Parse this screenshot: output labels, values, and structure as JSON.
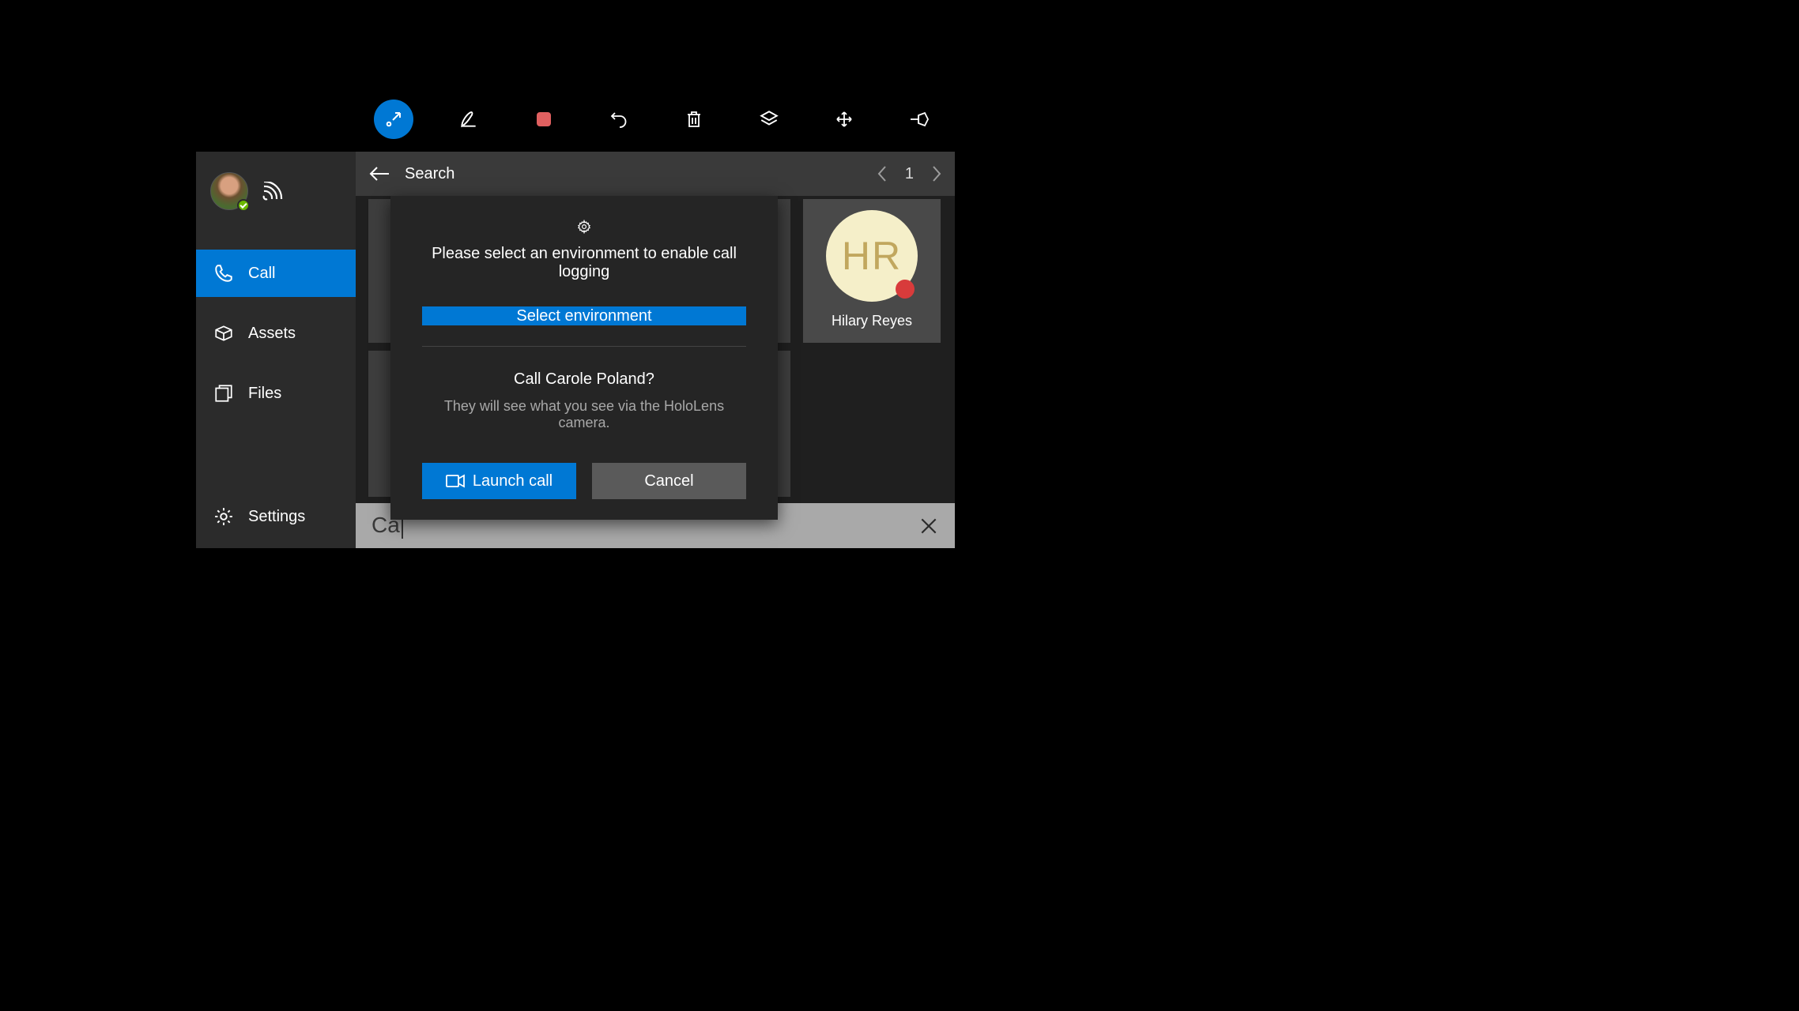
{
  "toolbar": {
    "icons": [
      "follow-icon",
      "ink-icon",
      "stop-record-icon",
      "undo-icon",
      "delete-icon",
      "layers-icon",
      "move-icon",
      "pin-icon"
    ]
  },
  "sidebar": {
    "items": [
      {
        "label": "Call"
      },
      {
        "label": "Assets"
      },
      {
        "label": "Files"
      }
    ],
    "settings_label": "Settings"
  },
  "header": {
    "title": "Search",
    "page_number": "1"
  },
  "contact": {
    "initials": "HR",
    "name": "Hilary Reyes"
  },
  "dialog": {
    "environment_prompt": "Please select an environment to enable call logging",
    "select_env_label": "Select environment",
    "call_question": "Call Carole Poland?",
    "call_subtext": "They will see what you see via the HoloLens camera.",
    "launch_label": "Launch call",
    "cancel_label": "Cancel"
  },
  "searchbar": {
    "value": "Ca"
  }
}
